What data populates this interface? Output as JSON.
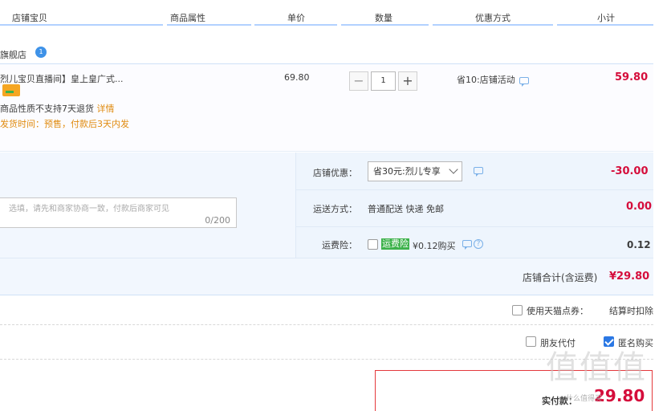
{
  "header": {
    "col_shop_item": "店铺宝贝",
    "col_attrs": "商品属性",
    "col_unit_price": "单价",
    "col_quantity": "数量",
    "col_promo": "优惠方式",
    "col_subtotal": "小计"
  },
  "shop": {
    "name": "旗舰店",
    "badge": "1"
  },
  "item": {
    "title": "烈儿宝贝直播间】皇上皇广式...",
    "note_return": "商品性质不支持7天退货",
    "note_return_link": "详情",
    "note_ship": "发货时间：预售，付款后3天内发",
    "unit_price": "69.80",
    "quantity": "1",
    "minus": "−",
    "plus": "+",
    "promo": "省10:店铺活动",
    "subtotal": "59.80"
  },
  "summary": {
    "shop_discount_label": "店铺优惠：",
    "shop_discount_selected": "省30元:烈儿专享",
    "shop_discount_value": "-30.00",
    "shipping_label": "运送方式：",
    "shipping_value": "普通配送 快递 免邮",
    "shipping_cost": "0.00",
    "insurance_label": "运费险：",
    "insurance_tag": "运费险",
    "insurance_price": "¥0.12购买",
    "insurance_cost": "0.12",
    "message_placeholder": "选填，请先和商家协商一致，付款后商家可见",
    "message_count": "0/200",
    "shop_total_label": "店铺合计(含运费)",
    "shop_total_value": "¥29.80",
    "help": "?"
  },
  "options": {
    "tmall_points_label": "使用天猫点券：",
    "tmall_points_note": "结算时扣除",
    "friend_pay_label": "朋友代付",
    "anonymous_label": "匿名购买",
    "anonymous_checked": true
  },
  "final": {
    "label": "实付款：",
    "value": "29.80"
  },
  "watermark": {
    "main": "值值值",
    "sub": "什么值得买"
  },
  "colors": {
    "price_red": "#d50d3b",
    "accent_blue": "#2b78e4",
    "header_line": "#b2d1ff",
    "warn_orange": "#e08b10",
    "tag_green": "#3db24b"
  }
}
